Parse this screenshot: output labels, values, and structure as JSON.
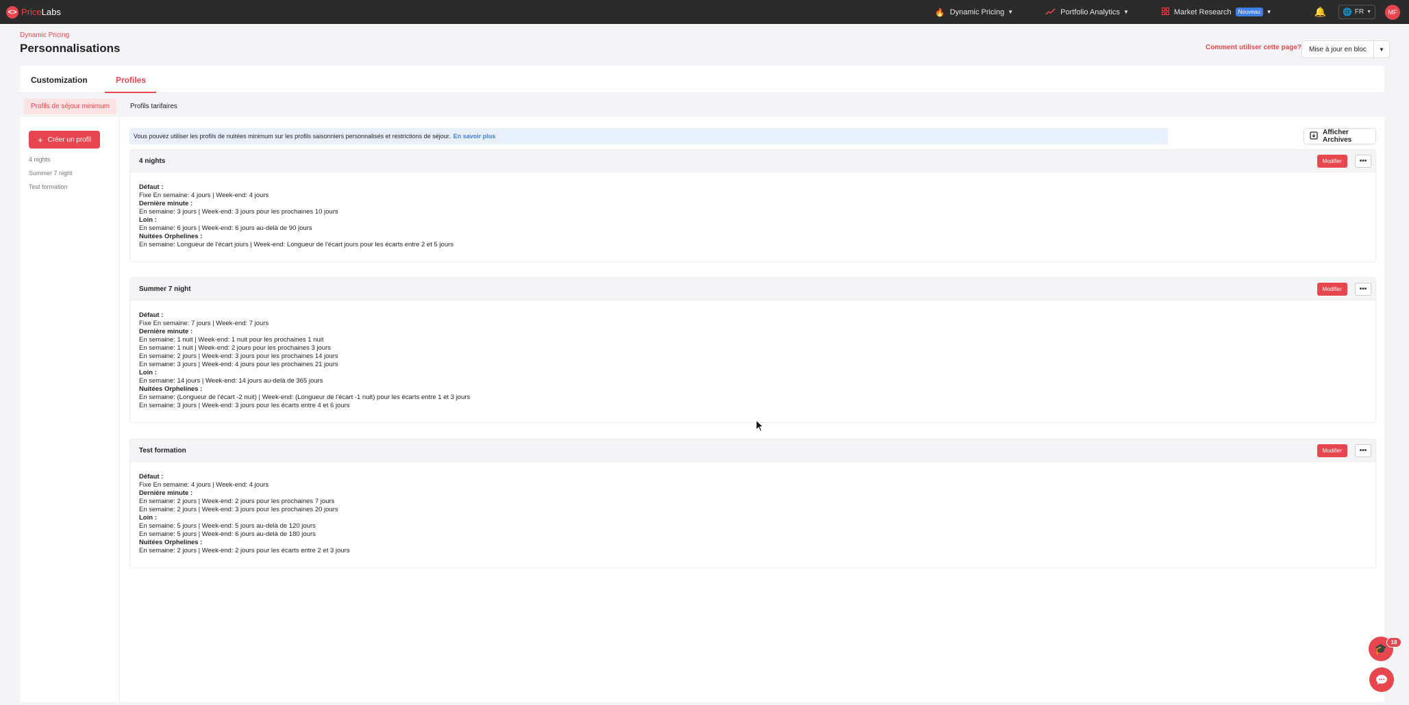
{
  "nav": {
    "logo_icon": "<>",
    "logo_part1": "Price",
    "logo_part2": "Labs",
    "dynamic_pricing": "Dynamic Pricing",
    "portfolio_analytics": "Portfolio Analytics",
    "market_research": "Market Research",
    "market_research_badge": "Nouveau",
    "language": "FR",
    "avatar_initials": "MF"
  },
  "header": {
    "breadcrumb": "Dynamic Pricing",
    "title": "Personnalisations",
    "help_link": "Comment utiliser cette page?",
    "bulk_update": "Mise à jour en bloc"
  },
  "tabs": {
    "customization": "Customization",
    "profiles": "Profiles"
  },
  "subtabs": {
    "min_stay": "Profils de séjour minimum",
    "pricing": "Profils tarifaires"
  },
  "sidebar": {
    "create_label": "Créer un profil",
    "items": [
      "4 nights",
      "Summer 7 night",
      "Test formation"
    ]
  },
  "info": {
    "text": "Vous pouvez utiliser les profils de nuitées minimum sur les profils saisonniers personnalisés et restrictions de séjour.",
    "link": "En savoir plus"
  },
  "archives_label": "Afficher Archives",
  "edit_label": "Modifier",
  "more_label": "•••",
  "profiles": [
    {
      "name": "4 nights",
      "lines": [
        {
          "text": "Défaut :",
          "heading": true
        },
        {
          "text": "Fixe En semaine: 4 jours | Week-end: 4 jours",
          "heading": false
        },
        {
          "text": "Dernière minute :",
          "heading": true
        },
        {
          "text": "En semaine: 3 jours | Week-end: 3 jours pour les prochaines 10 jours",
          "heading": false
        },
        {
          "text": "Loin :",
          "heading": true
        },
        {
          "text": "En semaine: 6 jours | Week-end: 6 jours au-delà de 90 jours",
          "heading": false
        },
        {
          "text": "Nuitées Orphelines :",
          "heading": true
        },
        {
          "text": "En semaine: Longueur de l'écart jours | Week-end: Longueur de l'écart jours pour les écarts entre 2 et 5 jours",
          "heading": false
        }
      ]
    },
    {
      "name": "Summer 7 night",
      "lines": [
        {
          "text": "Défaut :",
          "heading": true
        },
        {
          "text": "Fixe En semaine: 7 jours | Week-end: 7 jours",
          "heading": false
        },
        {
          "text": "Dernière minute :",
          "heading": true
        },
        {
          "text": "En semaine: 1 nuit | Week-end: 1 nuit pour les prochaines 1 nuit",
          "heading": false
        },
        {
          "text": "En semaine: 1 nuit | Week-end: 2 jours pour les prochaines 3 jours",
          "heading": false
        },
        {
          "text": "En semaine: 2 jours | Week-end: 3 jours pour les prochaines 14 jours",
          "heading": false
        },
        {
          "text": "En semaine: 3 jours | Week-end: 4 jours pour les prochaines 21 jours",
          "heading": false
        },
        {
          "text": "Loin :",
          "heading": true
        },
        {
          "text": "En semaine: 14 jours | Week-end: 14 jours au-delà de 365 jours",
          "heading": false
        },
        {
          "text": "Nuitées Orphelines :",
          "heading": true
        },
        {
          "text": "En semaine: (Longueur de l'écart -2 nuit) | Week-end: (Longueur de l'écart -1 nuit) pour les écarts entre 1 et 3 jours",
          "heading": false
        },
        {
          "text": "En semaine: 3 jours | Week-end: 3 jours pour les écarts entre 4 et 6 jours",
          "heading": false
        }
      ]
    },
    {
      "name": "Test formation",
      "lines": [
        {
          "text": "Défaut :",
          "heading": true
        },
        {
          "text": "Fixe En semaine: 4 jours | Week-end: 4 jours",
          "heading": false
        },
        {
          "text": "Dernière minute :",
          "heading": true
        },
        {
          "text": "En semaine: 2 jours | Week-end: 2 jours pour les prochaines 7 jours",
          "heading": false
        },
        {
          "text": "En semaine: 2 jours | Week-end: 3 jours pour les prochaines 20 jours",
          "heading": false
        },
        {
          "text": "Loin :",
          "heading": true
        },
        {
          "text": "En semaine: 5 jours | Week-end: 5 jours au-delà de 120 jours",
          "heading": false
        },
        {
          "text": "En semaine: 5 jours | Week-end: 6 jours au-delà de 180 jours",
          "heading": false
        },
        {
          "text": "Nuitées Orphelines :",
          "heading": true
        },
        {
          "text": "En semaine: 2 jours | Week-end: 2 jours pour les écarts entre 2 et 3 jours",
          "heading": false
        }
      ]
    }
  ],
  "help_badge": "18",
  "colors": {
    "accent": "#e8464e",
    "link": "#3f7fe4",
    "nav_bg": "#2b2b2b"
  }
}
